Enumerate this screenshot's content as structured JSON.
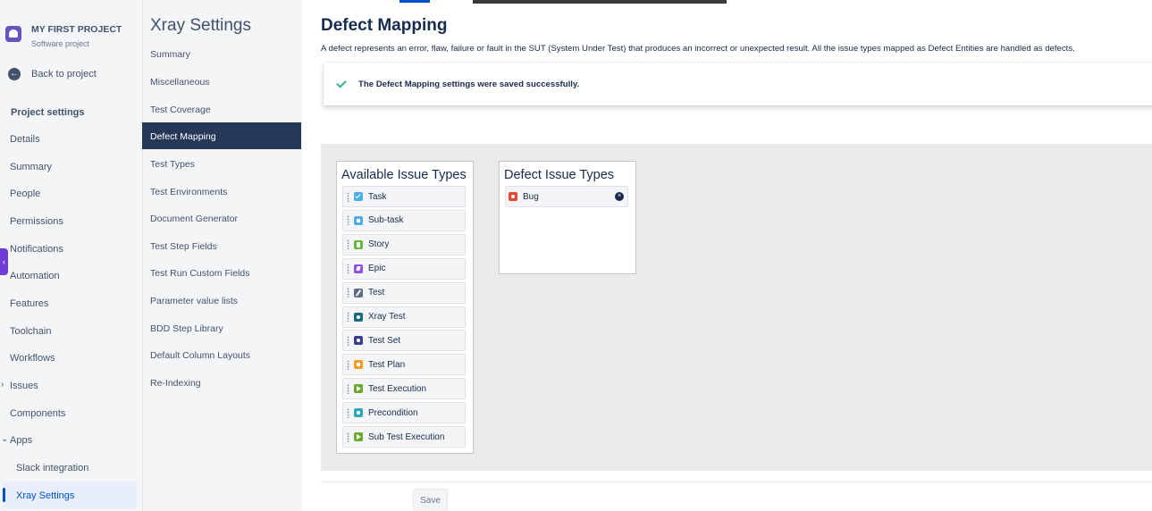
{
  "project": {
    "name": "MY FIRST PROJECT",
    "type": "Software project",
    "back_label": "Back to project",
    "settings_title": "Project settings"
  },
  "project_nav": {
    "items": [
      {
        "label": "Details"
      },
      {
        "label": "Summary"
      },
      {
        "label": "People"
      },
      {
        "label": "Permissions"
      },
      {
        "label": "Notifications"
      },
      {
        "label": "Automation"
      },
      {
        "label": "Features"
      },
      {
        "label": "Toolchain"
      },
      {
        "label": "Workflows"
      },
      {
        "label": "Issues",
        "expandable": true
      },
      {
        "label": "Components"
      },
      {
        "label": "Apps",
        "expanded": true
      },
      {
        "label": "Slack integration",
        "sub": true
      },
      {
        "label": "Xray Settings",
        "sub": true,
        "active": true
      }
    ]
  },
  "xray_nav": {
    "title": "Xray Settings",
    "items": [
      {
        "label": "Summary"
      },
      {
        "label": "Miscellaneous"
      },
      {
        "label": "Test Coverage"
      },
      {
        "label": "Defect Mapping",
        "active": true
      },
      {
        "label": "Test Types"
      },
      {
        "label": "Test Environments"
      },
      {
        "label": "Document Generator"
      },
      {
        "label": "Test Step Fields"
      },
      {
        "label": "Test Run Custom Fields"
      },
      {
        "label": "Parameter value lists"
      },
      {
        "label": "BDD Step Library"
      },
      {
        "label": "Default Column Layouts"
      },
      {
        "label": "Re-Indexing"
      }
    ]
  },
  "main": {
    "title": "Defect Mapping",
    "description": "A defect represents an error, flaw, failure or fault in the SUT (System Under Test) that produces an incorrect or unexpected result. All the issue types mapped as Defect Entities are handled as defects.",
    "success_message": "The Defect Mapping settings were saved successfully.",
    "available": {
      "title": "Available Issue Types",
      "items": [
        {
          "label": "Task",
          "icon": "task-icon",
          "color": "#4bade8"
        },
        {
          "label": "Sub-task",
          "icon": "subtask-icon",
          "color": "#4bade8"
        },
        {
          "label": "Story",
          "icon": "story-icon",
          "color": "#63ba3c"
        },
        {
          "label": "Epic",
          "icon": "epic-icon",
          "color": "#904ee2"
        },
        {
          "label": "Test",
          "icon": "test-icon",
          "color": "#5e6c84"
        },
        {
          "label": "Xray Test",
          "icon": "xray-test-icon",
          "color": "#1c6b7d"
        },
        {
          "label": "Test Set",
          "icon": "test-set-icon",
          "color": "#3d3e8f"
        },
        {
          "label": "Test Plan",
          "icon": "test-plan-icon",
          "color": "#f29b1d"
        },
        {
          "label": "Test Execution",
          "icon": "test-execution-icon",
          "color": "#6ba82d"
        },
        {
          "label": "Precondition",
          "icon": "precondition-icon",
          "color": "#2fa8b9"
        },
        {
          "label": "Sub Test Execution",
          "icon": "sub-test-execution-icon",
          "color": "#6ba82d"
        }
      ]
    },
    "defect": {
      "title": "Defect Issue Types",
      "items": [
        {
          "label": "Bug",
          "icon": "bug-icon",
          "color": "#e5493a"
        }
      ]
    },
    "save_label": "Save"
  }
}
